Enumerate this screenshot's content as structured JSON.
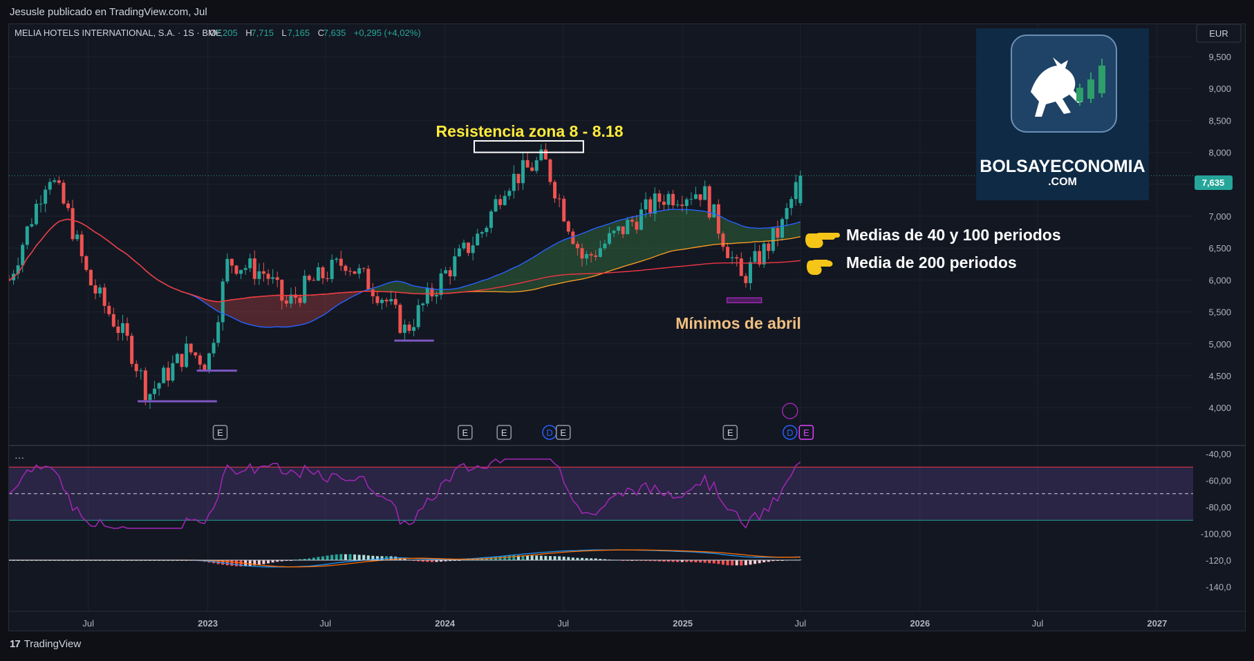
{
  "header": {
    "published_by": "Jesusle publicado en TradingView.com, Jul"
  },
  "legend": {
    "symbol": "MELIA HOTELS INTERNATIONAL, S.A. · 1S · BME",
    "o_label": "O",
    "o_value": "7,205",
    "h_label": "H",
    "h_value": "7,715",
    "l_label": "L",
    "l_value": "7,165",
    "c_label": "C",
    "c_value": "7,635",
    "change": "+0,295 (+4,02%)"
  },
  "currency": "EUR",
  "last_price_label": "7,635",
  "annotations": {
    "resistance": "Resistencia zona 8 - 8.18",
    "ma_40_100": "Medias de 40 y 100 periodos",
    "ma_200": "Media de 200 periodos",
    "april_lows": "Mínimos de abril"
  },
  "logo": {
    "line1": "BOLSAYECONOMIA",
    "line2": ".COM"
  },
  "event_markers": [
    "E",
    "E",
    "E",
    "D",
    "E",
    "E",
    "D",
    "E"
  ],
  "indicator_menu": "···",
  "footer": {
    "brand": "TradingView",
    "mark": "17"
  },
  "colors": {
    "up": "#26a69a",
    "down": "#ef5350",
    "ma40": "#2962ff",
    "ma100": "#f59a23",
    "ma200": "#f23645",
    "rsi": "#9c27b0",
    "resistance_text": "#ffeb3b",
    "lows_text": "#f0c080",
    "support_lines": "#7e57c2"
  },
  "chart_data": [
    {
      "type": "candlestick",
      "title": "MELIA HOTELS INTERNATIONAL, S.A. · 1S · BME",
      "x_tick_labels": [
        "Jul",
        "2023",
        "Jul",
        "2024",
        "Jul",
        "2025",
        "Jul",
        "2026",
        "Jul",
        "2027"
      ],
      "y_tick_labels": [
        "9,500",
        "9,000",
        "8,500",
        "8,000",
        "7,500",
        "7,000",
        "6,500",
        "6,000",
        "5,500",
        "5,000",
        "4,500",
        "4,000"
      ],
      "ylim": [
        3.75,
        9.9
      ],
      "time_range": [
        "2022-03",
        "2027-02"
      ],
      "last_close": 7.635,
      "price_path_approx": [
        {
          "t": "2022-03",
          "close": 6.0
        },
        {
          "t": "2022-05",
          "close": 7.7
        },
        {
          "t": "2022-06",
          "close": 7.0
        },
        {
          "t": "2022-07",
          "close": 6.0
        },
        {
          "t": "2022-09",
          "close": 5.0
        },
        {
          "t": "2022-10",
          "close": 4.2
        },
        {
          "t": "2022-12",
          "close": 4.9
        },
        {
          "t": "2023-01",
          "close": 4.7
        },
        {
          "t": "2023-02",
          "close": 6.3
        },
        {
          "t": "2023-04",
          "close": 6.1
        },
        {
          "t": "2023-05",
          "close": 5.6
        },
        {
          "t": "2023-06",
          "close": 5.9
        },
        {
          "t": "2023-08",
          "close": 6.3
        },
        {
          "t": "2023-10",
          "close": 5.7
        },
        {
          "t": "2023-11",
          "close": 5.2
        },
        {
          "t": "2024-01",
          "close": 6.1
        },
        {
          "t": "2024-03",
          "close": 6.8
        },
        {
          "t": "2024-04",
          "close": 7.5
        },
        {
          "t": "2024-06",
          "close": 7.9
        },
        {
          "t": "2024-07",
          "close": 7.1
        },
        {
          "t": "2024-08",
          "close": 6.3
        },
        {
          "t": "2024-10",
          "close": 6.8
        },
        {
          "t": "2024-12",
          "close": 7.3
        },
        {
          "t": "2025-02",
          "close": 7.4
        },
        {
          "t": "2025-04",
          "close": 6.0
        },
        {
          "t": "2025-06",
          "close": 6.8
        },
        {
          "t": "2025-07",
          "close": 7.635
        }
      ],
      "moving_averages": [
        {
          "name": "MA 40",
          "color": "#2962ff"
        },
        {
          "name": "MA 100",
          "color": "#f59a23"
        },
        {
          "name": "MA 200",
          "color": "#f23645"
        }
      ],
      "resistance_zone": [
        8.0,
        8.18
      ],
      "grid": true
    },
    {
      "type": "line",
      "y_tick_labels": [
        "-40,00",
        "-60,00",
        "-80,00",
        "-100,00",
        "-120,0",
        "-140,0"
      ],
      "ylim": [
        -147,
        -38
      ],
      "bands": [
        -50,
        -70,
        -90
      ],
      "grid": true
    }
  ]
}
